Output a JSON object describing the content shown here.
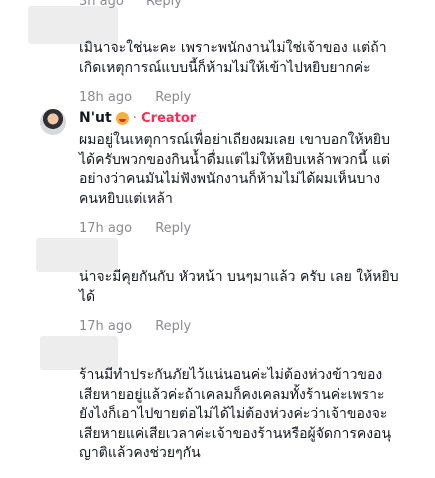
{
  "reply_label": "Reply",
  "top_meta": {
    "time": "3h ago"
  },
  "comments": [
    {
      "text": "เมินาจะใช่นะคะ เพราะพนักงานไม่ใช่เจ้าของ แต่ถ้า\nเกิดเหตุการณ์แบบนี้ก็ห้ามไม่ให้เข้าไปหยิบยากค่ะ",
      "time": "18h ago"
    },
    {
      "author": "N'ut",
      "badge": "Creator",
      "text": "ผมอยู่ในเหตุการณ์เพื่อย่าเถียงผมเลย เขาบอกให้หยิบ\nได้ครับพวกของกินน้ำดื่มแต่ไม่ให้หยิบเหล้าพวกนี้ แต่\nอย่างว่าคนมันไม่ฟังพนักงานก็ห้ามไม่ได้ผมเห็นบาง\nคนหยิบแต่เหล้า",
      "time": "17h ago"
    },
    {
      "text": "น่าจะมีคุยกันกับ หัวหน้า บนๆมาแล้ว ครับ เลย ให้หยิบ\nได้",
      "time": "17h ago"
    },
    {
      "text": "ร้านมีทำประกันภัยไว้แน่นอนค่ะไม่ต้องห่วงข้าวของ\nเสียหายอยู่แล้วค่ะถ้าเคลมก็คงเคลมทั้งร้านค่ะเพราะ\nยังไงก็เอาไปขายต่อไม่ได้ไม่ต้องห่วงค่ะว่าเจ้าของจะ\nเสียหายแค่เสียเวลาค่ะเจ้าของร้านหรือผู้จัดการคงอนุ\nญาติแล้วคงช่วยๆกัน"
    }
  ]
}
